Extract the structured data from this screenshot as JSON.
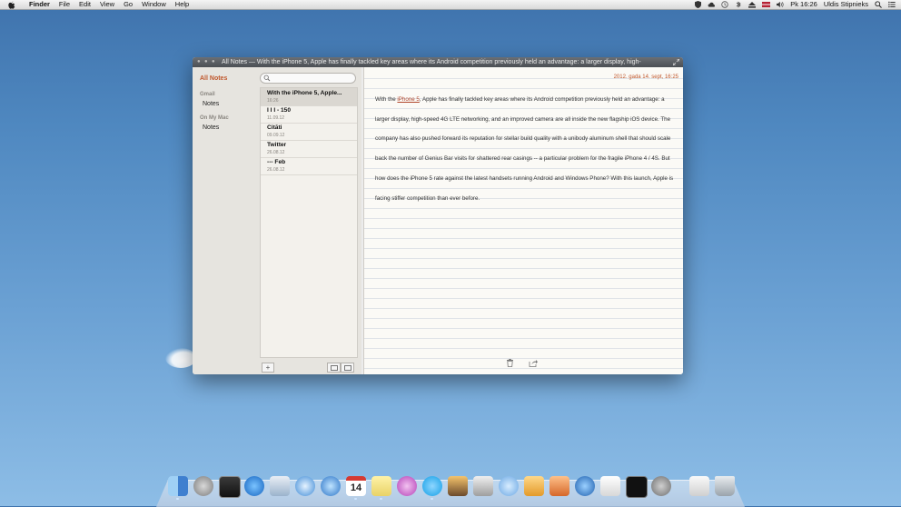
{
  "menubar": {
    "app_name": "Finder",
    "menus": [
      "File",
      "Edit",
      "View",
      "Go",
      "Window",
      "Help"
    ],
    "clock": "Pk 16:26",
    "user": "Uldis Stipnieks"
  },
  "window": {
    "title": "All Notes — With the iPhone 5, Apple has finally tackled key areas where its Android competition previously held an advantage: a larger display, high-"
  },
  "sidebar": {
    "all_notes": "All Notes",
    "gmail_header": "Gmail",
    "gmail_notes": "Notes",
    "mac_header": "On My Mac",
    "mac_notes": "Notes"
  },
  "search": {
    "placeholder": ""
  },
  "notes": [
    {
      "title": "With the iPhone 5, Apple...",
      "date": "16:26"
    },
    {
      "title": "I I I - 150",
      "date": "11.09.12"
    },
    {
      "title": "Citāti",
      "date": "09.09.12"
    },
    {
      "title": "Twitter",
      "date": "26.08.12"
    },
    {
      "title": "--- Feb",
      "date": "26.08.12"
    }
  ],
  "list_footer": {
    "add_label": "+"
  },
  "editor": {
    "date": "2012. gada 14. sept, 16:25",
    "body_pre": "With the ",
    "body_link": "iPhone 5",
    "body_post": ", Apple has finally tackled key areas where its Android competition previously held an advantage: a larger display, high-speed 4G LTE networking, and an improved camera are all inside the new flagship iOS device. The company has also pushed forward its reputation for stellar build quality with a unibody aluminum shell that should scale back the number of Genius Bar visits for shattered rear casings -- a particular problem for the fragile iPhone 4 / 4S. But how does the iPhone 5 rate against the latest handsets running Android and Windows Phone? With this launch, Apple is facing stiffer competition than ever before."
  },
  "colors": {
    "accent": "#c0572c",
    "desktop": "#5b93c9"
  },
  "dock": {
    "calendar_day": "14",
    "apps": [
      "finder-icon",
      "launchpad-icon",
      "photo-booth-icon",
      "app-store-icon",
      "preview-icon",
      "safari-icon",
      "itunes-icon",
      "calendar-icon",
      "notes-icon",
      "itunes-ping-icon",
      "skype-icon",
      "iphoto-icon",
      "photos-icon",
      "messages-icon",
      "pages-icon",
      "keynote-icon",
      "quicktime-icon",
      "textedit-icon",
      "activity-monitor-icon",
      "system-preferences-icon",
      "downloads-stack-icon",
      "trash-icon"
    ]
  }
}
